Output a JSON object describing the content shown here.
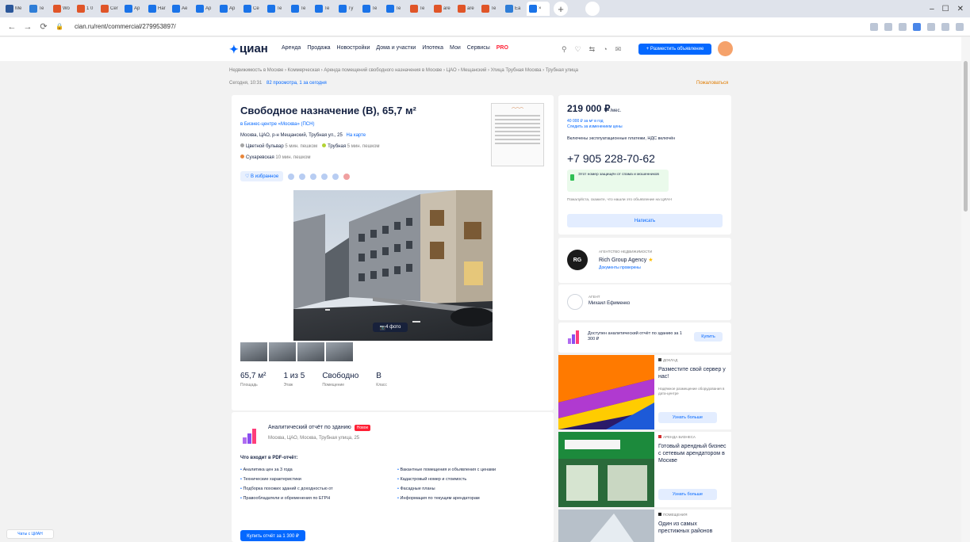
{
  "browser": {
    "tabs": [
      {
        "label": "Me",
        "color": "#2b579a"
      },
      {
        "label": "Te",
        "color": "#2e7dd7"
      },
      {
        "label": "Wo",
        "color": "#e05528"
      },
      {
        "label": "1 0",
        "color": "#e05528"
      },
      {
        "label": "Cer",
        "color": "#e05528"
      },
      {
        "label": "Ap",
        "color": "#1a73e8"
      },
      {
        "label": "Har",
        "color": "#1a73e8"
      },
      {
        "label": "Ae",
        "color": "#1a73e8"
      },
      {
        "label": "Ap",
        "color": "#1a73e8"
      },
      {
        "label": "Ap",
        "color": "#1a73e8"
      },
      {
        "label": "Ce",
        "color": "#1a73e8"
      },
      {
        "label": "Te",
        "color": "#1a73e8"
      },
      {
        "label": "Te",
        "color": "#1a73e8"
      },
      {
        "label": "Te",
        "color": "#1a73e8"
      },
      {
        "label": "Ty",
        "color": "#1a73e8"
      },
      {
        "label": "Te",
        "color": "#1a73e8"
      },
      {
        "label": "Te",
        "color": "#1a73e8"
      },
      {
        "label": "Te",
        "color": "#e05528"
      },
      {
        "label": "are",
        "color": "#e05528"
      },
      {
        "label": "are",
        "color": "#e05528"
      },
      {
        "label": "Te",
        "color": "#e05528"
      },
      {
        "label": "Ea",
        "color": "#2e7dd7"
      },
      {
        "label": "×",
        "color": "#1a73e8"
      }
    ],
    "url": "cian.ru/rent/commercial/279953897/"
  },
  "header": {
    "logo": "циан",
    "nav": [
      "Аренда",
      "Продажа",
      "Новостройки",
      "Дома и участки",
      "Ипотека",
      "Мои",
      "Сервисы"
    ],
    "nav_hot": "PRO",
    "post_button": "+ Разместить объявление"
  },
  "breadcrumbs": "Недвижимость в Москве  ›  Коммерческая  ›  Аренда помещений свободного назначения в Москве  ›  ЦАО  ›  Мещанский  ›  Улица Трубная Москва  ›  Трубная улица",
  "updated": "Сегодня, 10:31",
  "views": "82 просмотра, 1 за сегодня",
  "complain": "Пожаловаться",
  "listing": {
    "title": "Свободное назначение (B), 65,7 м²",
    "bc_name": "в Бизнес-центре «Москва» (ПСН)",
    "address": "Москва, ЦАО, р-н Мещанский, Трубная ул., 25",
    "map_link": "На карте",
    "metro": [
      {
        "name": "Цветной бульвар",
        "walk": "5 мин. пешком",
        "color": "#a4a4a4"
      },
      {
        "name": "Трубная",
        "walk": "5 мин. пешком",
        "color": "#b3d334"
      },
      {
        "name": "Сухаревская",
        "walk": "10 мин. пешком",
        "color": "#e8863a"
      }
    ],
    "favorite": "В избранное",
    "photo_button": "4 фото",
    "specs": [
      {
        "value": "65,7 м²",
        "label": "Площадь"
      },
      {
        "value": "1 из 5",
        "label": "Этаж"
      },
      {
        "value": "Свободно",
        "label": "Помещение"
      },
      {
        "value": "B",
        "label": "Класс"
      }
    ]
  },
  "report": {
    "title": "Аналитический отчёт по зданию",
    "badge": "Новое",
    "address": "Москва, ЦАО, Москва, Трубная улица, 25",
    "subtitle": "Что входит в PDF-отчёт:",
    "items": [
      "Аналитика цен за 3 года",
      "Вакантные помещения и объявления с ценами",
      "Технические характеристики",
      "Кадастровый номер и стоимость",
      "Подборка похожих зданий с доходностью от",
      "Фасадные планы",
      "Правообладатели и обременения по ЕГРН",
      "Информация по текущим арендаторам"
    ],
    "button": "Купить отчёт за 1 300 ₽"
  },
  "price": {
    "value": "219 000 ₽",
    "period": "/мес.",
    "sub1": "40 000 ₽ за м² в год",
    "sub2": "Следить за изменением цены",
    "commission": "Включены эксплуатационные платежи, НДС включён",
    "phone": "+7 905 228-70-62",
    "callout": "Этот номер защищён от спама и мошенников",
    "note": "Пожалуйста, скажите, что нашли это объявление на ЦИАН",
    "write_button": "Написать"
  },
  "agency": {
    "kicker": "АГЕНТСТВО НЕДВИЖИМОСТИ",
    "name": "Rich Group Agency",
    "docs": "Документы проверены",
    "logo": "RG"
  },
  "contact": {
    "kicker": "АГЕНТ",
    "name": "Михаил Ефименко"
  },
  "bureau": {
    "text": "Доступен аналитический отчёт по зданию за 1 300 ₽",
    "button": "Купить"
  },
  "ads": [
    {
      "source": "ДОКЛАД",
      "title": "Разместите свой сервер у нас!",
      "desc": "Надёжное размещение оборудования в дата-центре",
      "button": "Узнать больше"
    },
    {
      "source": "АРЕНДА БИЗНЕСА",
      "title": "Готовый арендный бизнес с сетевым арендатором в Москве",
      "desc": "",
      "button": "Узнать больше"
    },
    {
      "source": "ПОМЕЩЕНИЯ",
      "title": "Один из самых престижных районов",
      "desc": "",
      "button": ""
    }
  ],
  "chat": "Чаты с ЦИАН"
}
